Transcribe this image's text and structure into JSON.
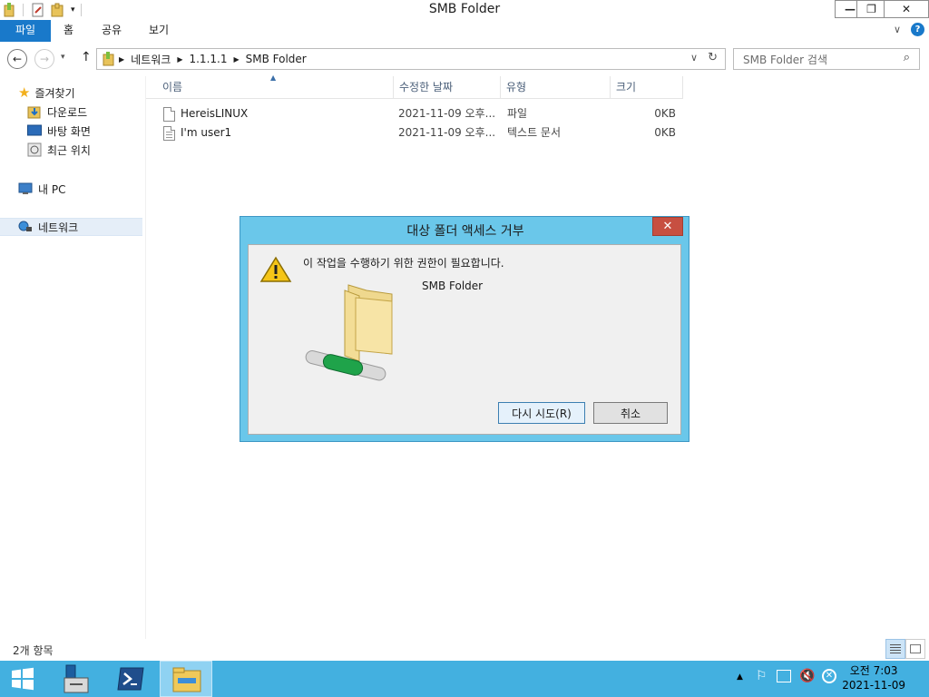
{
  "window": {
    "title": "SMB Folder",
    "minimize_label": "—",
    "restore_label": "❐",
    "close_label": "✕"
  },
  "ribbon": {
    "tabs": [
      {
        "label": "파일",
        "active": true
      },
      {
        "label": "홈"
      },
      {
        "label": "공유"
      },
      {
        "label": "보기"
      }
    ],
    "expand_icon": "chevron-down-icon",
    "help_icon": "help-icon"
  },
  "address": {
    "breadcrumb": [
      "네트워크",
      "1.1.1.1",
      "SMB Folder"
    ],
    "search_placeholder": "SMB Folder 검색"
  },
  "nav": {
    "favorites_label": "즐겨찾기",
    "favorites_children": [
      "다운로드",
      "바탕 화면",
      "최근 위치"
    ],
    "pc_label": "내 PC",
    "network_label": "네트워크"
  },
  "filelist": {
    "columns": [
      "이름",
      "수정한 날짜",
      "유형",
      "크기"
    ],
    "rows": [
      {
        "name": "HereisLINUX",
        "modified": "2021-11-09 오후...",
        "type": "파일",
        "size": "0KB",
        "icon": "blank-file-icon"
      },
      {
        "name": "I'm user1",
        "modified": "2021-11-09 오후...",
        "type": "텍스트 문서",
        "size": "0KB",
        "icon": "text-file-icon"
      }
    ]
  },
  "status": {
    "item_count": "2개 항목"
  },
  "dialog": {
    "title": "대상 폴더 액세스 거부",
    "close_label": "✕",
    "message": "이 작업을 수행하기 위한 권한이 필요합니다.",
    "folder_name": "SMB Folder",
    "retry_label": "다시 시도(R)",
    "cancel_label": "취소"
  },
  "taskbar": {
    "clock_time": "오전 7:03",
    "clock_date": "2021-11-09"
  },
  "colors": {
    "accent": "#1979ca",
    "dialog_frame": "#6ac7ea",
    "taskbar": "#43b0e0",
    "close_red": "#c74f41"
  }
}
